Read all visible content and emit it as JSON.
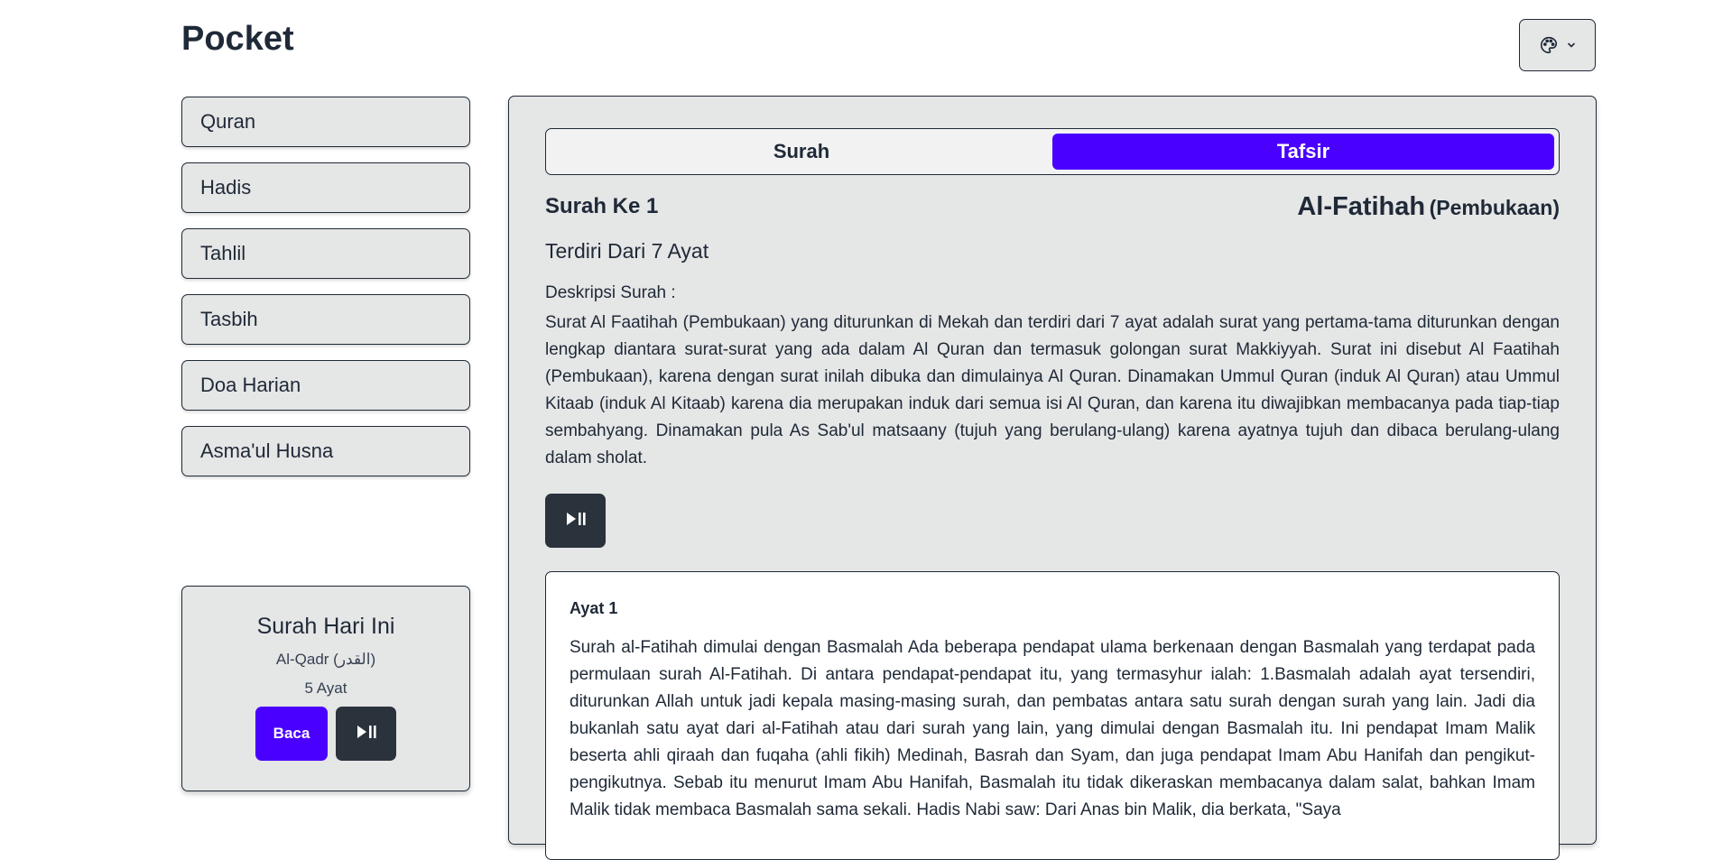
{
  "app": {
    "title": "Pocket"
  },
  "theme_button": {
    "icon": "palette-icon",
    "chevron": "chevron-down-icon"
  },
  "nav": [
    {
      "label": "Quran"
    },
    {
      "label": "Hadis"
    },
    {
      "label": "Tahlil"
    },
    {
      "label": "Tasbih"
    },
    {
      "label": "Doa Harian"
    },
    {
      "label": "Asma'ul Husna"
    }
  ],
  "today": {
    "title": "Surah Hari Ini",
    "name": "Al-Qadr (القدر)",
    "ayat": "5 Ayat",
    "read_label": "Baca",
    "play_icon": "play-pause-icon"
  },
  "tabs": [
    {
      "label": "Surah",
      "active": false
    },
    {
      "label": "Tafsir",
      "active": true
    }
  ],
  "surah": {
    "number_label": "Surah Ke 1",
    "latin": "Al-Fatihah",
    "meaning": "(Pembukaan)",
    "ayat_count": "Terdiri Dari 7 Ayat",
    "desc_label": "Deskripsi Surah :",
    "desc": "Surat Al Faatihah (Pembukaan) yang diturunkan di Mekah dan terdiri dari 7 ayat adalah surat yang pertama-tama diturunkan dengan lengkap diantara surat-surat yang ada dalam Al Quran dan termasuk golongan surat Makkiyyah. Surat ini disebut Al Faatihah (Pembukaan), karena dengan surat inilah dibuka dan dimulainya Al Quran. Dinamakan Ummul Quran (induk Al Quran) atau Ummul Kitaab (induk Al Kitaab) karena dia merupakan induk dari semua isi Al Quran, dan karena itu diwajibkan membacanya pada tiap-tiap sembahyang. Dinamakan pula As Sab'ul matsaany (tujuh yang berulang-ulang) karena ayatnya tujuh dan dibaca berulang-ulang dalam sholat."
  },
  "tafsir": {
    "ayat_label": "Ayat 1",
    "text": "Surah al-Fatihah dimulai dengan Basmalah Ada beberapa pendapat ulama berkenaan dengan Basmalah yang terdapat pada permulaan surah Al-Fatihah. Di antara pendapat-pendapat itu, yang termasyhur ialah: 1.Basmalah adalah ayat tersendiri, diturunkan Allah untuk jadi kepala masing-masing surah, dan pembatas antara satu surah dengan surah yang lain. Jadi dia bukanlah satu ayat dari al-Fatihah atau dari surah yang lain, yang dimulai dengan Basmalah itu. Ini pendapat Imam Malik beserta ahli qiraah dan fuqaha (ahli fikih) Medinah, Basrah dan Syam, dan juga pendapat Imam Abu Hanifah dan pengikut-pengikutnya. Sebab itu menurut Imam Abu Hanifah, Basmalah itu tidak dikeraskan membacanya dalam salat, bahkan Imam Malik tidak membaca Basmalah sama sekali. Hadis Nabi saw: Dari Anas bin Malik, dia berkata, \"Saya"
  },
  "colors": {
    "primary": "#4a00ff",
    "neutral": "#2a323c",
    "card_bg": "#e5e6e6",
    "text": "#1f2937"
  }
}
